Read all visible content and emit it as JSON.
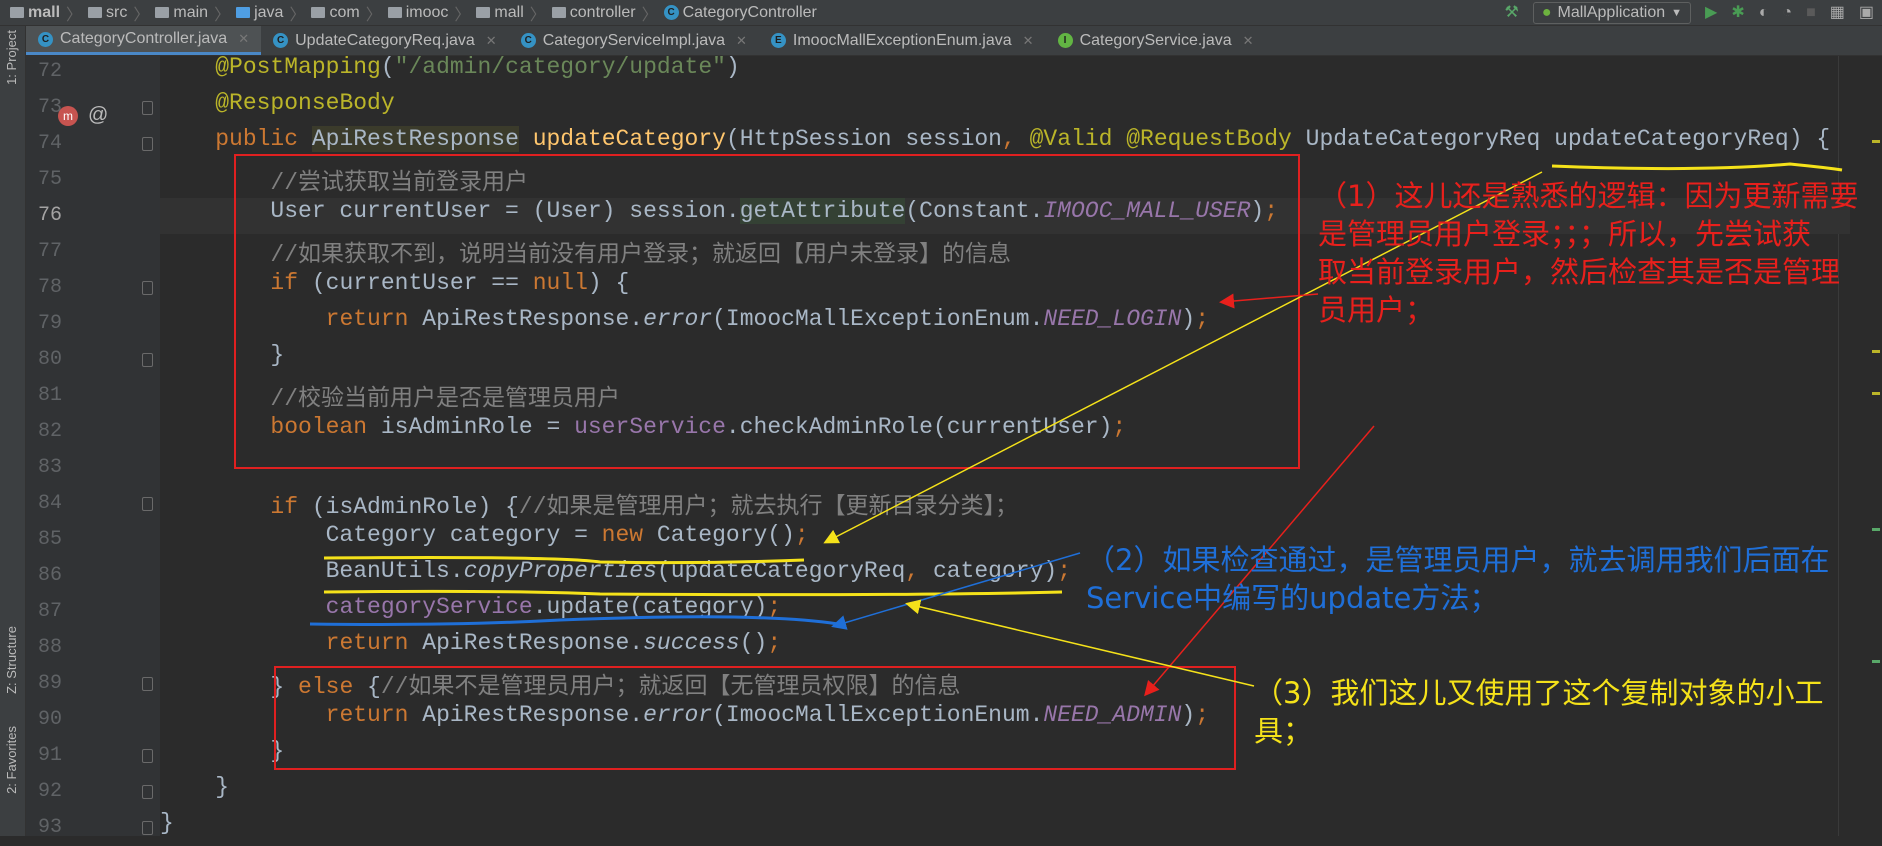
{
  "breadcrumb": [
    "mall",
    "src",
    "main",
    "java",
    "com",
    "imooc",
    "mall",
    "controller",
    "CategoryController"
  ],
  "run_config": "MallApplication",
  "tabs": [
    {
      "label": "CategoryController.java",
      "icon": "C",
      "active": true
    },
    {
      "label": "UpdateCategoryReq.java",
      "icon": "C"
    },
    {
      "label": "CategoryServiceImpl.java",
      "icon": "C"
    },
    {
      "label": "ImoocMallExceptionEnum.java",
      "icon": "E"
    },
    {
      "label": "CategoryService.java",
      "icon": "I"
    }
  ],
  "side_tools": {
    "project": "1: Project",
    "structure": "Z: Structure",
    "favorites": "2: Favorites"
  },
  "code": {
    "first_line": 72,
    "current_line": 76,
    "lines": [
      [
        [
          "",
          "    "
        ],
        [
          "an",
          "@PostMapping"
        ],
        [
          "",
          "("
        ],
        [
          "str",
          "\"/admin/category/update\""
        ],
        [
          "",
          ")"
        ]
      ],
      [
        [
          "",
          "    "
        ],
        [
          "an",
          "@ResponseBody"
        ]
      ],
      [
        [
          "",
          "    "
        ],
        [
          "kw",
          "public "
        ],
        [
          "hl2",
          "ApiRestResponse"
        ],
        [
          "",
          " "
        ],
        [
          "mdecl",
          "updateCategory"
        ],
        [
          "",
          "(HttpSession session"
        ],
        [
          "kw",
          ", "
        ],
        [
          "an",
          "@Valid @RequestBody "
        ],
        [
          "",
          "UpdateCategoryReq updateCategoryReq) {"
        ]
      ],
      [
        [
          "",
          "        "
        ],
        [
          "cm",
          "//尝试获取当前登录用户"
        ]
      ],
      [
        [
          "",
          "        User currentUser = (User) session."
        ],
        [
          "hl",
          "getAttribute"
        ],
        [
          "",
          "(Constant."
        ],
        [
          "sfld",
          "IMOOC_MALL_USER"
        ],
        [
          "",
          ")"
        ],
        [
          "kw",
          ";"
        ]
      ],
      [
        [
          "",
          "        "
        ],
        [
          "cm",
          "//如果获取不到，说明当前没有用户登录；就返回【用户未登录】的信息"
        ]
      ],
      [
        [
          "",
          "        "
        ],
        [
          "kw",
          "if "
        ],
        [
          "",
          "(currentUser == "
        ],
        [
          "kw",
          "null"
        ],
        [
          "",
          ") {"
        ]
      ],
      [
        [
          "",
          "            "
        ],
        [
          "kw",
          "return "
        ],
        [
          "",
          "ApiRestResponse."
        ],
        [
          "it",
          "error"
        ],
        [
          "",
          "(ImoocMallExceptionEnum."
        ],
        [
          "sfld",
          "NEED_LOGIN"
        ],
        [
          "",
          ")"
        ],
        [
          "kw",
          ";"
        ]
      ],
      [
        [
          "",
          "        }"
        ]
      ],
      [
        [
          "",
          "        "
        ],
        [
          "cm",
          "//校验当前用户是否是管理员用户"
        ]
      ],
      [
        [
          "",
          "        "
        ],
        [
          "kw",
          "boolean "
        ],
        [
          "",
          "isAdminRole = "
        ],
        [
          "fld",
          "userService"
        ],
        [
          "",
          ".checkAdminRole(currentUser)"
        ],
        [
          "kw",
          ";"
        ]
      ],
      [],
      [
        [
          "",
          "        "
        ],
        [
          "kw",
          "if "
        ],
        [
          "",
          "(isAdminRole) {"
        ],
        [
          "cm",
          "//如果是管理用户；就去执行【更新目录分类】；"
        ]
      ],
      [
        [
          "",
          "            Category category = "
        ],
        [
          "kw",
          "new "
        ],
        [
          "",
          "Category()"
        ],
        [
          "kw",
          ";"
        ]
      ],
      [
        [
          "",
          "            BeanUtils."
        ],
        [
          "it",
          "copyProperties"
        ],
        [
          "",
          "(updateCategoryReq"
        ],
        [
          "kw",
          ", "
        ],
        [
          "",
          "category)"
        ],
        [
          "kw",
          ";"
        ]
      ],
      [
        [
          "",
          "            "
        ],
        [
          "fld",
          "categoryService"
        ],
        [
          "",
          ".update(category)"
        ],
        [
          "kw",
          ";"
        ]
      ],
      [
        [
          "",
          "            "
        ],
        [
          "kw",
          "return "
        ],
        [
          "",
          "ApiRestResponse."
        ],
        [
          "it",
          "success"
        ],
        [
          "",
          "()"
        ],
        [
          "kw",
          ";"
        ]
      ],
      [
        [
          "",
          "        } "
        ],
        [
          "kw",
          "else "
        ],
        [
          "",
          "{"
        ],
        [
          "cm",
          "//如果不是管理员用户；就返回【无管理员权限】的信息"
        ]
      ],
      [
        [
          "",
          "            "
        ],
        [
          "kw",
          "return "
        ],
        [
          "",
          "ApiRestResponse."
        ],
        [
          "it",
          "error"
        ],
        [
          "",
          "(ImoocMallExceptionEnum."
        ],
        [
          "sfld",
          "NEED_ADMIN"
        ],
        [
          "",
          ")"
        ],
        [
          "kw",
          ";"
        ]
      ],
      [
        [
          "",
          "        }"
        ]
      ],
      [
        [
          "",
          "    }"
        ]
      ],
      [
        [
          "",
          "}"
        ]
      ]
    ]
  },
  "annotations": {
    "note1": [
      "（1）这儿还是熟悉的逻辑：因为更新需要",
      "是管理员用户登录；；；所以，先尝试获",
      "取当前登录用户，然后检查其是否是管理",
      "员用户；"
    ],
    "note2": [
      "（2）如果检查通过，是管理员用户，就去调用我们后面在",
      "Service中编写的update方法；"
    ],
    "note3": [
      "（3）我们这儿又使用了这个复制对象的小工",
      "具；"
    ]
  },
  "colors": {
    "red": "#e8201c",
    "blue": "#1f6fd8",
    "yellow": "#f5e21a"
  }
}
